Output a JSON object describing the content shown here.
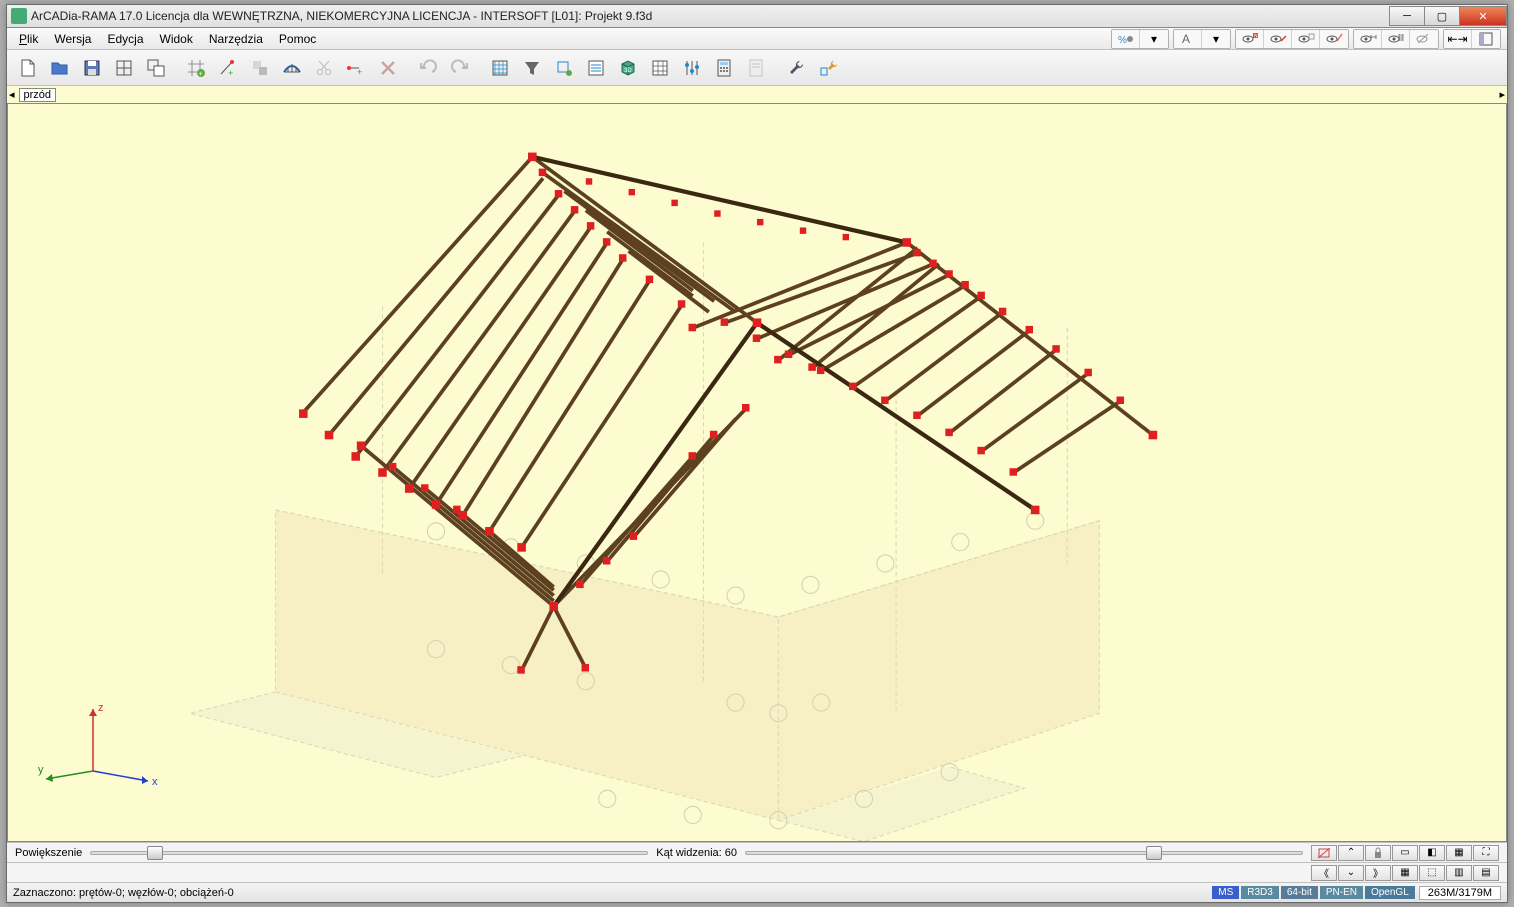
{
  "title": "ArCADia-RAMA 17.0 Licencja dla WEWNĘTRZNA, NIEKOMERCYJNA LICENCJA - INTERSOFT [L01]: Projekt 9.f3d",
  "menu": {
    "plik": "Plik",
    "wersja": "Wersja",
    "edycja": "Edycja",
    "widok": "Widok",
    "narzedzia": "Narzędzia",
    "pomoc": "Pomoc"
  },
  "viewlabel": "przód",
  "sliders": {
    "zoom_label": "Powiększenie",
    "fov_label": "Kąt widzenia: 60"
  },
  "status": {
    "sel": "Zaznaczono: prętów-0; węzłów-0; obciążeń-0",
    "mem": "263M/3179M",
    "b1": "MS",
    "b2": "R3D3",
    "b3": "64-bit",
    "b4": "PN-EN",
    "b5": "OpenGL"
  },
  "axes": {
    "x": "x",
    "y": "y",
    "z": "z"
  }
}
